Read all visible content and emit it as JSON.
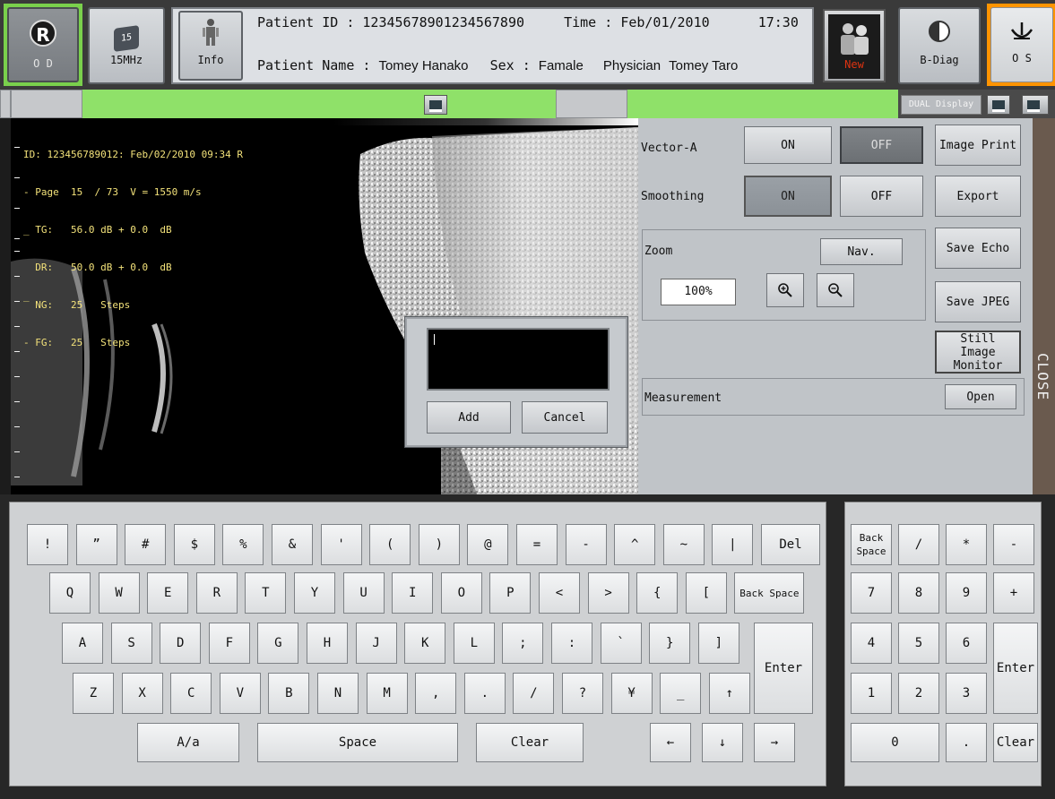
{
  "toolbar": {
    "od": {
      "label": "O D",
      "badge": "R"
    },
    "freq": {
      "label": "15MHz",
      "badge": "15"
    },
    "info": {
      "label": "Info"
    },
    "new": {
      "label": "New"
    },
    "bdiag": {
      "label": "B-Diag"
    },
    "os": {
      "label": "O S"
    }
  },
  "patient": {
    "id_label": "Patient ID :",
    "id_value": "12345678901234567890",
    "time_label": "Time :",
    "date_value": "Feb/01/2010",
    "time_value": "17:30",
    "name_label": "Patient Name :",
    "name_value": "Tomey Hanako",
    "sex_label": "Sex :",
    "sex_value": "Famale",
    "physician_label": "Physician",
    "physician_value": "Tomey Taro"
  },
  "strip": {
    "dual_display_label": "DUAL Display"
  },
  "image_overlay": {
    "line1": "ID: 123456789012: Feb/02/2010 09:34 R",
    "line2": "- Page  15  / 73  V = 1550 m/s",
    "line3": "_ TG:   56.0 dB + 0.0  dB",
    "line4": "  DR:   50.0 dB + 0.0  dB",
    "line5": "‾ NG:   25   Steps",
    "line6": "- FG:   25   Steps"
  },
  "control_panel": {
    "vector_a_label": "Vector-A",
    "vector_a_on": "ON",
    "vector_a_off": "OFF",
    "vector_a_state": "OFF",
    "smoothing_label": "Smoothing",
    "smoothing_on": "ON",
    "smoothing_off": "OFF",
    "smoothing_state": "ON",
    "image_print_label": "Image Print",
    "export_label": "Export",
    "zoom_label": "Zoom",
    "nav_label": "Nav.",
    "zoom_value": "100%",
    "save_echo_label": "Save Echo",
    "save_jpeg_label": "Save JPEG",
    "still_image_monitor_label": "Still Image Monitor",
    "measurement_label": "Measurement",
    "open_label": "Open",
    "close_tab_label": "CLOSE"
  },
  "dialog": {
    "text_value": "",
    "add_label": "Add",
    "cancel_label": "Cancel"
  },
  "keyboard": {
    "row1": [
      "!",
      "”",
      "#",
      "$",
      "%",
      "&",
      "'",
      "(",
      ")",
      "@",
      "=",
      "-",
      "^",
      "~",
      "|",
      "Del"
    ],
    "row2": [
      "Q",
      "W",
      "E",
      "R",
      "T",
      "Y",
      "U",
      "I",
      "O",
      "P",
      "<",
      ">",
      "{",
      "[",
      "Back Space"
    ],
    "row3": [
      "A",
      "S",
      "D",
      "F",
      "G",
      "H",
      "J",
      "K",
      "L",
      ";",
      ":",
      "`",
      "}",
      "]"
    ],
    "row4": [
      "Z",
      "X",
      "C",
      "V",
      "B",
      "N",
      "M",
      ",",
      ".",
      "/",
      "?",
      "¥",
      "_",
      "↑"
    ],
    "enter_label": "Enter",
    "shift_label": "A/a",
    "space_label": "Space",
    "clear_label": "Clear",
    "arrow_left": "←",
    "arrow_down": "↓",
    "arrow_right": "→"
  },
  "numpad": {
    "row1": [
      "Back Space",
      "/",
      "*",
      "-"
    ],
    "row2": [
      "7",
      "8",
      "9",
      "+"
    ],
    "row3": [
      "4",
      "5",
      "6"
    ],
    "row4": [
      "1",
      "2",
      "3"
    ],
    "zero": "0",
    "dot": ".",
    "enter_label": "Enter",
    "clear_label": "Clear"
  },
  "colors": {
    "accent_green": "#8fe169",
    "accent_orange": "#ff9400",
    "overlay_yellow": "#f3e27a"
  }
}
